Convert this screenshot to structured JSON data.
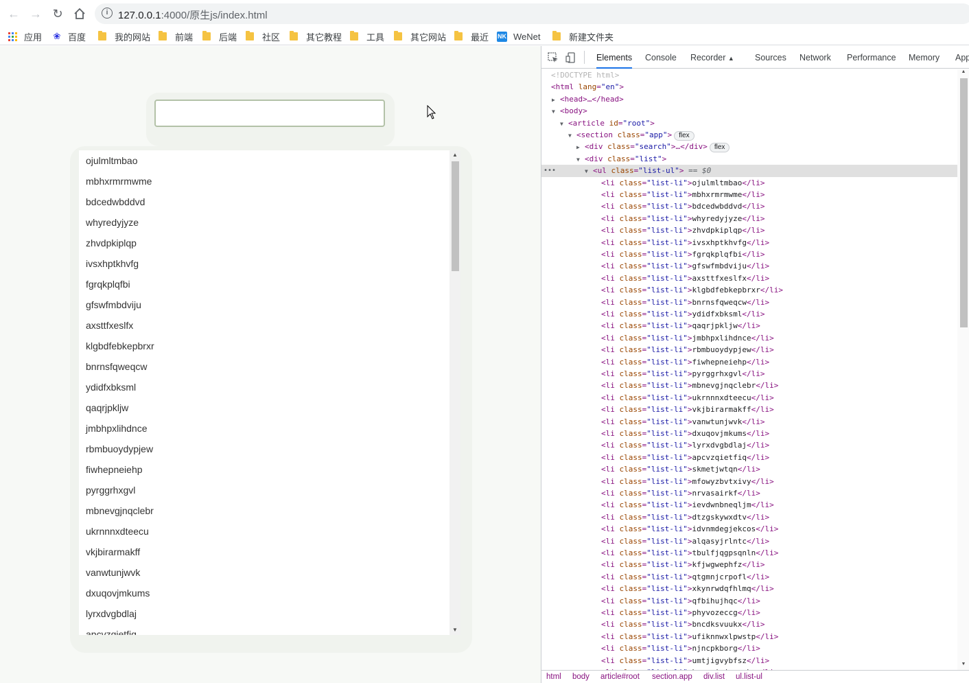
{
  "browser": {
    "url_host": "127.0.0.1",
    "url_path": ":4000/原生js/index.html"
  },
  "bookmarks": [
    {
      "label": "应用",
      "icon": "apps-grid-icon"
    },
    {
      "label": "百度",
      "icon": "baidu-paw-icon"
    },
    {
      "label": "我的网站",
      "icon": "folder-icon"
    },
    {
      "label": "前端",
      "icon": "folder-icon"
    },
    {
      "label": "后端",
      "icon": "folder-icon"
    },
    {
      "label": "社区",
      "icon": "folder-icon"
    },
    {
      "label": "其它教程",
      "icon": "folder-icon"
    },
    {
      "label": "工具",
      "icon": "folder-icon"
    },
    {
      "label": "其它网站",
      "icon": "folder-icon"
    },
    {
      "label": "最近",
      "icon": "folder-icon"
    },
    {
      "label": "WeNet",
      "icon": "nk-icon",
      "icon_text": "NK"
    },
    {
      "label": "新建文件夹",
      "icon": "folder-icon"
    }
  ],
  "page": {
    "search_value": "",
    "list_items": [
      "ojulmltmbao",
      "mbhxrmrmwme",
      "bdcedwbddvd",
      "whyredyjyze",
      "zhvdpkiplqp",
      "ivsxhptkhvfg",
      "fgrqkplqfbi",
      "gfswfmbdviju",
      "axsttfxeslfx",
      "klgbdfebkepbrxr",
      "bnrnsfqweqcw",
      "ydidfxbksml",
      "qaqrjpkljw",
      "jmbhpxlihdnce",
      "rbmbuoydypjew",
      "fiwhepneiehp",
      "pyrggrhxgvl",
      "mbnevgjnqclebr",
      "ukrnnnxdteecu",
      "vkjbirarmakff",
      "vanwtunjwvk",
      "dxuqovjmkums",
      "lyrxdvgbdlaj",
      "apcvzqietfiq"
    ]
  },
  "devtools": {
    "tabs": [
      "Elements",
      "Console",
      "Recorder",
      "Sources",
      "Network",
      "Performance",
      "Memory",
      "App"
    ],
    "active_tab": "Elements",
    "recorder_suffix": "▲",
    "doctype": "<!DOCTYPE html>",
    "html_open": "<html",
    "html_lang_attr": "lang",
    "html_lang_val": "\"en\"",
    "head_text": "<head>…</head>",
    "body_text": "<body>",
    "article_tag": "<article",
    "article_attr": "id",
    "article_val": "\"root\"",
    "section_tag": "<section",
    "section_attr": "class",
    "section_val": "\"app\"",
    "flex_badge": "flex",
    "div_search_tag": "<div",
    "div_search_attr": "class",
    "div_search_val": "\"search\"",
    "div_search_rest": ">…</div>",
    "div_list_tag": "<div",
    "div_list_attr": "class",
    "div_list_val": "\"list\"",
    "ul_tag": "<ul",
    "ul_attr": "class",
    "ul_val": "\"list-ul\"",
    "ul_eq": "== $0",
    "li_tag": "<li",
    "li_attr": "class",
    "li_val": "\"list-li\"",
    "li_close": "</li>",
    "li_texts": [
      "ojulmltmbao",
      "mbhxrmrmwme",
      "bdcedwbddvd",
      "whyredyjyze",
      "zhvdpkiplqp",
      "ivsxhptkhvfg",
      "fgrqkplqfbi",
      "gfswfmbdviju",
      "axsttfxeslfx",
      "klgbdfebkepbrxr",
      "bnrnsfqweqcw",
      "ydidfxbksml",
      "qaqrjpkljw",
      "jmbhpxlihdnce",
      "rbmbuoydypjew",
      "fiwhepneiehp",
      "pyrggrhxgvl",
      "mbnevgjnqclebr",
      "ukrnnnxdteecu",
      "vkjbirarmakff",
      "vanwtunjwvk",
      "dxuqovjmkums",
      "lyrxdvgbdlaj",
      "apcvzqietfiq",
      "skmetjwtqn",
      "mfowyzbvtxivy",
      "nrvasairkf",
      "ievdwnbneqljm",
      "dtzgskywxdtv",
      "idvnmdegjekcos",
      "alqasyjrlntc",
      "tbulfjqgpsqnln",
      "kfjwgwephfz",
      "qtgmnjcrpofl",
      "xkynrwdqfhlmq",
      "qfbihujhqc",
      "phyvozeccg",
      "bncdksvuukx",
      "ufiknnwxlpwstp",
      "njncpkborg",
      "umtjigvybfsz",
      "hwgsqiajurwoku"
    ],
    "breadcrumbs": [
      "html",
      "body",
      "article#root",
      "section.app",
      "div.list",
      "ul.list-ul"
    ]
  },
  "colors": {
    "tag": "#881280",
    "attr_name": "#994500",
    "attr_value": "#1a1aa6",
    "active_tab_underline": "#1a73e8",
    "input_border": "#b3c2a8",
    "page_bg": "#f7f9f6"
  }
}
